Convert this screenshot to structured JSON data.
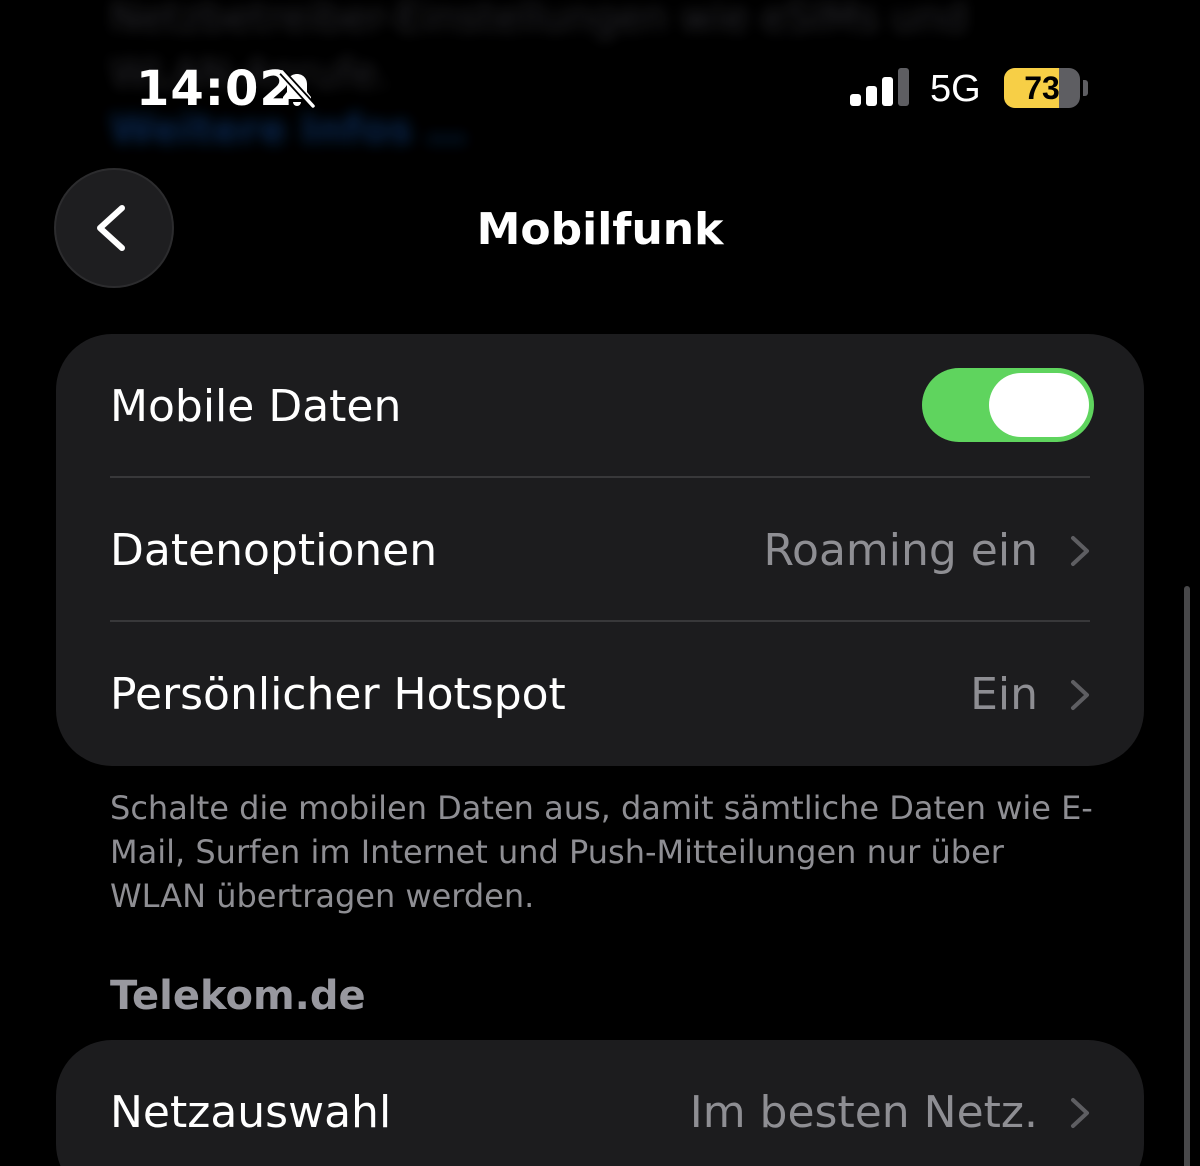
{
  "status_bar": {
    "time": "14:02",
    "network": "5G",
    "battery_level": "73",
    "battery_fraction": 0.73,
    "icons": [
      "bell-slash-icon",
      "cellular-signal-icon",
      "battery-icon"
    ]
  },
  "behind": {
    "line1": "Netzbetreiber-Einstellungen wie eSIMs und",
    "line2": "WLAN-Anrufe.",
    "link": "Weitere Infos …"
  },
  "nav": {
    "title": "Mobilfunk",
    "back_icon": "chevron-left-icon"
  },
  "data_group": {
    "mobile_data_label": "Mobile Daten",
    "mobile_data_on": true,
    "data_options_label": "Datenoptionen",
    "data_options_value": "Roaming ein",
    "hotspot_label": "Persönlicher Hotspot",
    "hotspot_value": "Ein"
  },
  "footer": {
    "note": "Schalte die mobilen Daten aus, damit sämtliche Daten wie E-Mail, Surfen im Internet und Push-Mitteilungen nur über WLAN übertragen werden."
  },
  "carrier_section": {
    "header": "Telekom.de",
    "network_selection_label": "Netzauswahl",
    "network_selection_value": "Im besten Netz."
  },
  "colors": {
    "background": "#000000",
    "group_background": "#1c1c1e",
    "toggle_on": "#5fd45e",
    "secondary_text": "#8e8e93",
    "battery_fill": "#f7cf46"
  }
}
